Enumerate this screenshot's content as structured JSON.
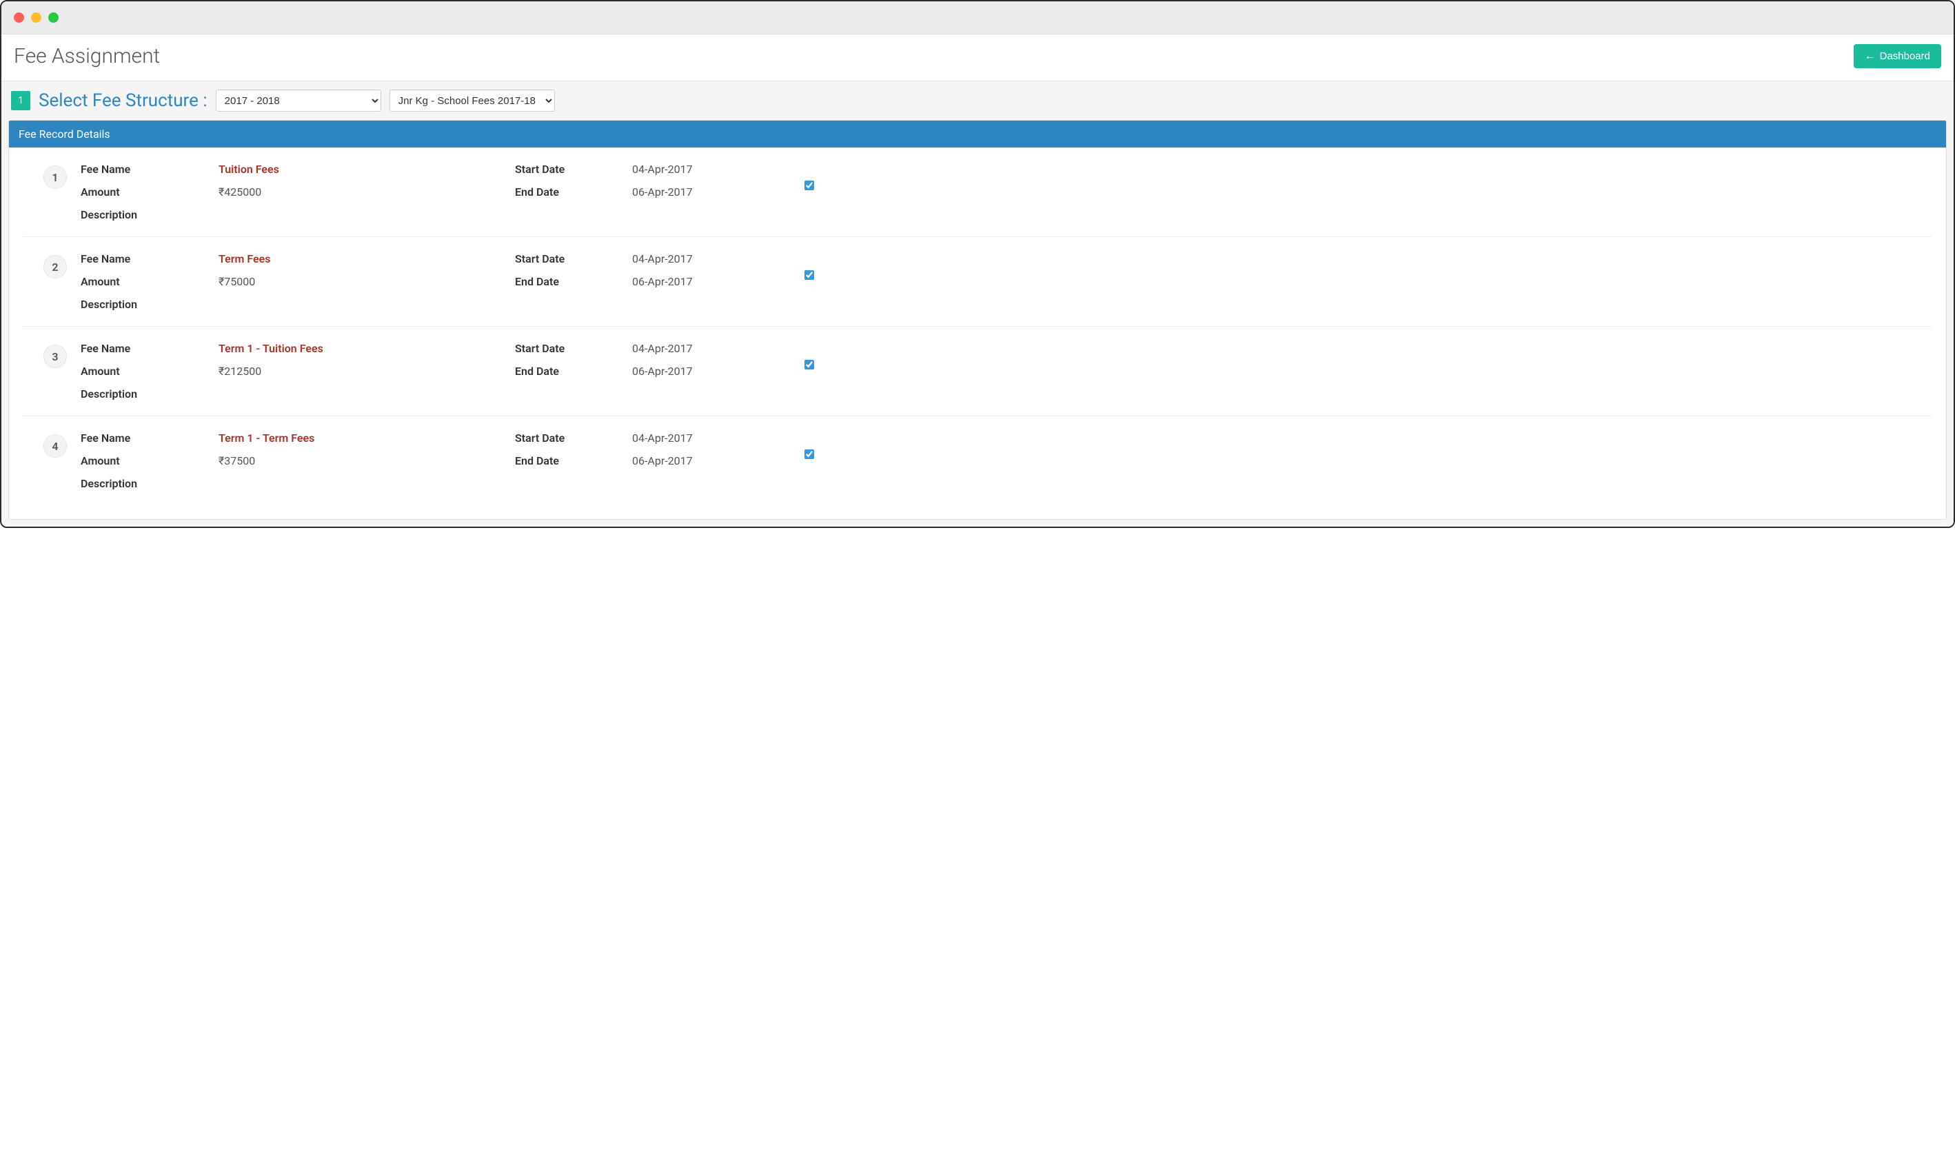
{
  "header": {
    "title": "Fee Assignment",
    "dashboard_label": "Dashboard"
  },
  "step": {
    "number": "1",
    "label": "Select Fee Structure :",
    "year_selected": "2017 - 2018",
    "structure_selected": "Jnr Kg - School Fees 2017-18"
  },
  "panel": {
    "title": "Fee Record Details"
  },
  "labels": {
    "fee_name": "Fee Name",
    "amount": "Amount",
    "description": "Description",
    "start_date": "Start Date",
    "end_date": "End Date"
  },
  "records": [
    {
      "num": "1",
      "fee_name": "Tuition Fees",
      "amount": "₹425000",
      "description": "",
      "start_date": "04-Apr-2017",
      "end_date": "06-Apr-2017",
      "checked": true
    },
    {
      "num": "2",
      "fee_name": "Term Fees",
      "amount": "₹75000",
      "description": "",
      "start_date": "04-Apr-2017",
      "end_date": "06-Apr-2017",
      "checked": true
    },
    {
      "num": "3",
      "fee_name": "Term 1 - Tuition Fees",
      "amount": "₹212500",
      "description": "",
      "start_date": "04-Apr-2017",
      "end_date": "06-Apr-2017",
      "checked": true
    },
    {
      "num": "4",
      "fee_name": "Term 1 - Term Fees",
      "amount": "₹37500",
      "description": "",
      "start_date": "04-Apr-2017",
      "end_date": "06-Apr-2017",
      "checked": true
    }
  ]
}
